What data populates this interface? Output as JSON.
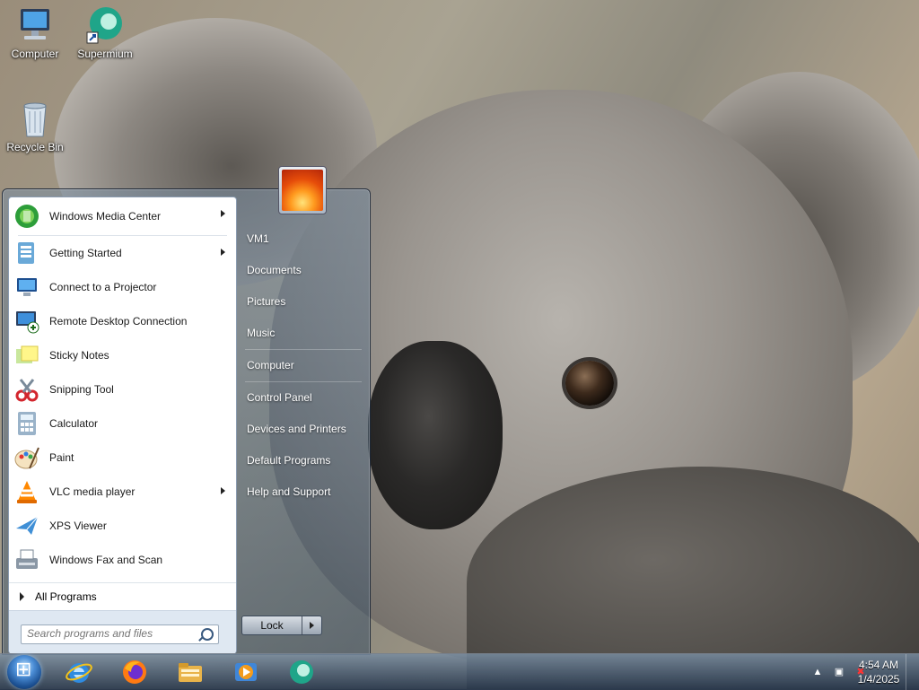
{
  "desktop": {
    "icons": [
      {
        "label": "Computer",
        "icon": "computer-icon"
      },
      {
        "label": "Supermium",
        "icon": "supermium-icon"
      },
      {
        "label": "Recycle Bin",
        "icon": "recycle-bin-icon"
      }
    ]
  },
  "start_menu": {
    "programs": [
      {
        "label": "Windows Media Center",
        "icon": "windows-media-center-icon",
        "submenu": true
      },
      {
        "label": "Getting Started",
        "icon": "getting-started-icon",
        "submenu": true
      },
      {
        "label": "Connect to a Projector",
        "icon": "projector-icon",
        "submenu": false
      },
      {
        "label": "Remote Desktop Connection",
        "icon": "remote-desktop-icon",
        "submenu": false
      },
      {
        "label": "Sticky Notes",
        "icon": "sticky-notes-icon",
        "submenu": false
      },
      {
        "label": "Snipping Tool",
        "icon": "snipping-tool-icon",
        "submenu": false
      },
      {
        "label": "Calculator",
        "icon": "calculator-icon",
        "submenu": false
      },
      {
        "label": "Paint",
        "icon": "paint-icon",
        "submenu": false
      },
      {
        "label": "VLC media player",
        "icon": "vlc-icon",
        "submenu": true
      },
      {
        "label": "XPS Viewer",
        "icon": "xps-viewer-icon",
        "submenu": false
      },
      {
        "label": "Windows Fax and Scan",
        "icon": "fax-scan-icon",
        "submenu": false
      }
    ],
    "all_programs": "All Programs",
    "search_placeholder": "Search programs and files",
    "right_links": [
      "VM1",
      "Documents",
      "Pictures",
      "Music",
      "Computer",
      "Control Panel",
      "Devices and Printers",
      "Default Programs",
      "Help and Support"
    ],
    "lock_label": "Lock"
  },
  "taskbar": {
    "apps": [
      "internet-explorer-icon",
      "firefox-icon",
      "file-explorer-icon",
      "media-player-icon",
      "supermium-icon"
    ],
    "clock_time": "4:54 AM",
    "clock_date": "1/4/2025"
  }
}
